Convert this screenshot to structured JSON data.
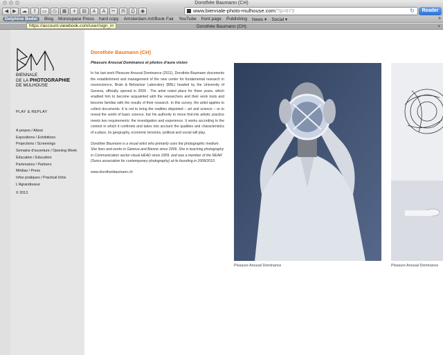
{
  "window": {
    "title": "Dorothée Baumann (CH)"
  },
  "toolbar": {
    "url_main": "www.biennale-photo-mulhouse.com",
    "url_query": "/?p=673",
    "reader_label": "Reader",
    "font_small": "A",
    "font_large": "A"
  },
  "bookmarks": {
    "items": [
      "Delphine Bedel",
      "Blog",
      "Monospace Press",
      "hard copy",
      "Amsterdam Art/Book Fair",
      "YouTube",
      "front page",
      "Publishing",
      "News ▾",
      "Social ▾"
    ]
  },
  "tooltip": {
    "text": "https://account.viewbook.com/user/sign_in"
  },
  "tab": {
    "title": "Dorothée Baumann (CH)"
  },
  "sidebar": {
    "logo_lines": [
      "BIENNALE",
      "DE LA",
      "PHOTOGRAPHIE",
      "DE MULHOUSE"
    ],
    "tagline": "PLAY & REPLAY",
    "nav": [
      "A propos / About",
      "Expositions / Exhibitions",
      "Projections / Screenings",
      "Semaine d'ouverture / Opening Week",
      "Éducation / Education",
      "Partenaires / Partners",
      "Médias / Press",
      "Infos pratiques / Practical Infos",
      "L'Agrandisseur"
    ],
    "copyright": "© 2013"
  },
  "content": {
    "artist_name": "Dorothée Baumann (CH)",
    "work_title": "Pleasure Arousal Dominance  et photos d'aura vision",
    "body": "In his last work Pleasure Arousal Dominance (2011), Dorothée Baumann documents the establishment and management of the new center for fundamental research in neuroscience, Brain & Behaviour Laboratory (BBL) headed by the University of Geneva, officially opened in 2009 . The artist noted place for three years, which enabled him to become acquainted with the researchers and their work tools and become familiar with the results of their research. In this survey, the artist applies to collect documents. It is not to bring the realities disjointed – art and science – or to reveal the world of basic science, but his authority to move first.His artistic practice meets two requirements: the investigation and experience. It works according to the context in which it confronts and takes into account the qualities and characteristics of a place, its geography, economic tensions, political and social will play.",
    "bio": "Dorothée Baumann is a visual artist who primarily uses the photographic medium. She lives and works in Geneva and Bienne since 2006. She is teaching photography in Communication sector visual HEAD since 2009, and was a member of the NEAR (Swiss association for contemporary photography) at its founding in 2008/2010.",
    "website": "www.dorotheebaumann.ch"
  },
  "gallery": {
    "caption1": "Pleasure Arousal Dominance",
    "caption2": "Pleasure Arousal Dominance"
  },
  "colors": {
    "accent": "#e8751a",
    "reader": "#2e6fd0"
  }
}
